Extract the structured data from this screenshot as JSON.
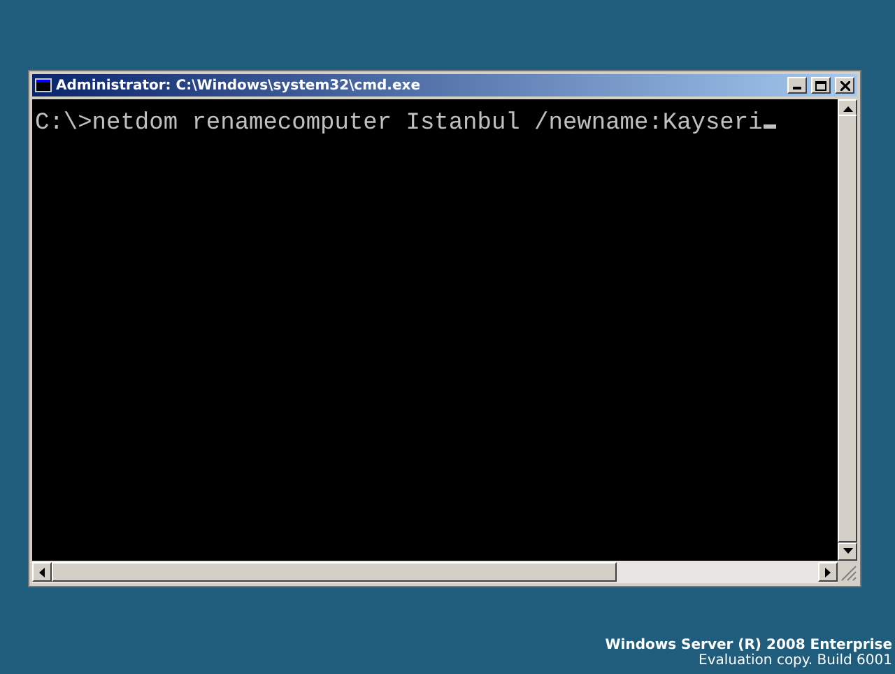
{
  "window": {
    "title": "Administrator: C:\\Windows\\system32\\cmd.exe"
  },
  "console": {
    "lines": [
      "C:\\>netdom renamecomputer Istanbul /newname:Kayseri"
    ],
    "cursor_visible": true
  },
  "desktop_branding": {
    "edition": "Windows Server (R) 2008 Enterprise",
    "build": "Evaluation copy. Build 6001"
  }
}
